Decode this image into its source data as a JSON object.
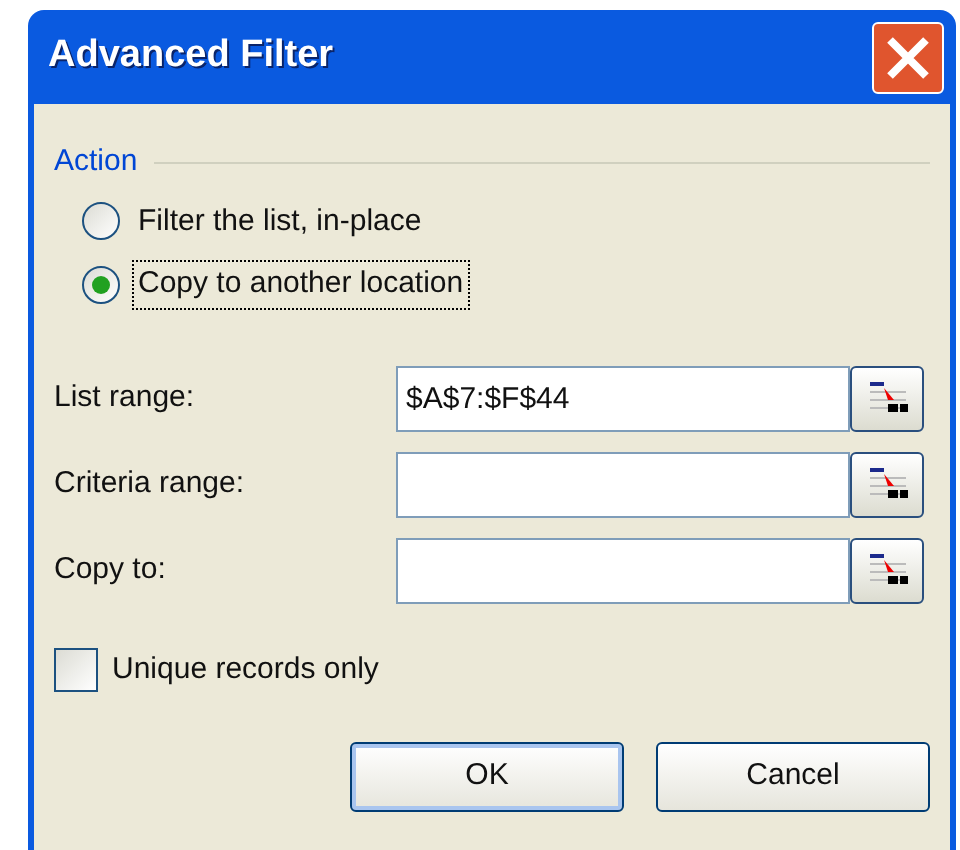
{
  "window": {
    "title": "Advanced Filter"
  },
  "action": {
    "label": "Action",
    "options": [
      {
        "label": "Filter the list, in-place",
        "selected": false
      },
      {
        "label": "Copy to another location",
        "selected": true
      }
    ]
  },
  "fields": [
    {
      "label": "List range:",
      "value": "$A$7:$F$44"
    },
    {
      "label": "Criteria range:"
    },
    {
      "label": "Copy to:"
    }
  ],
  "unique": {
    "label": "Unique records only",
    "checked": false
  },
  "buttons": [
    {
      "label": "OK",
      "default": true
    },
    {
      "label": "Cancel",
      "default": false
    }
  ]
}
